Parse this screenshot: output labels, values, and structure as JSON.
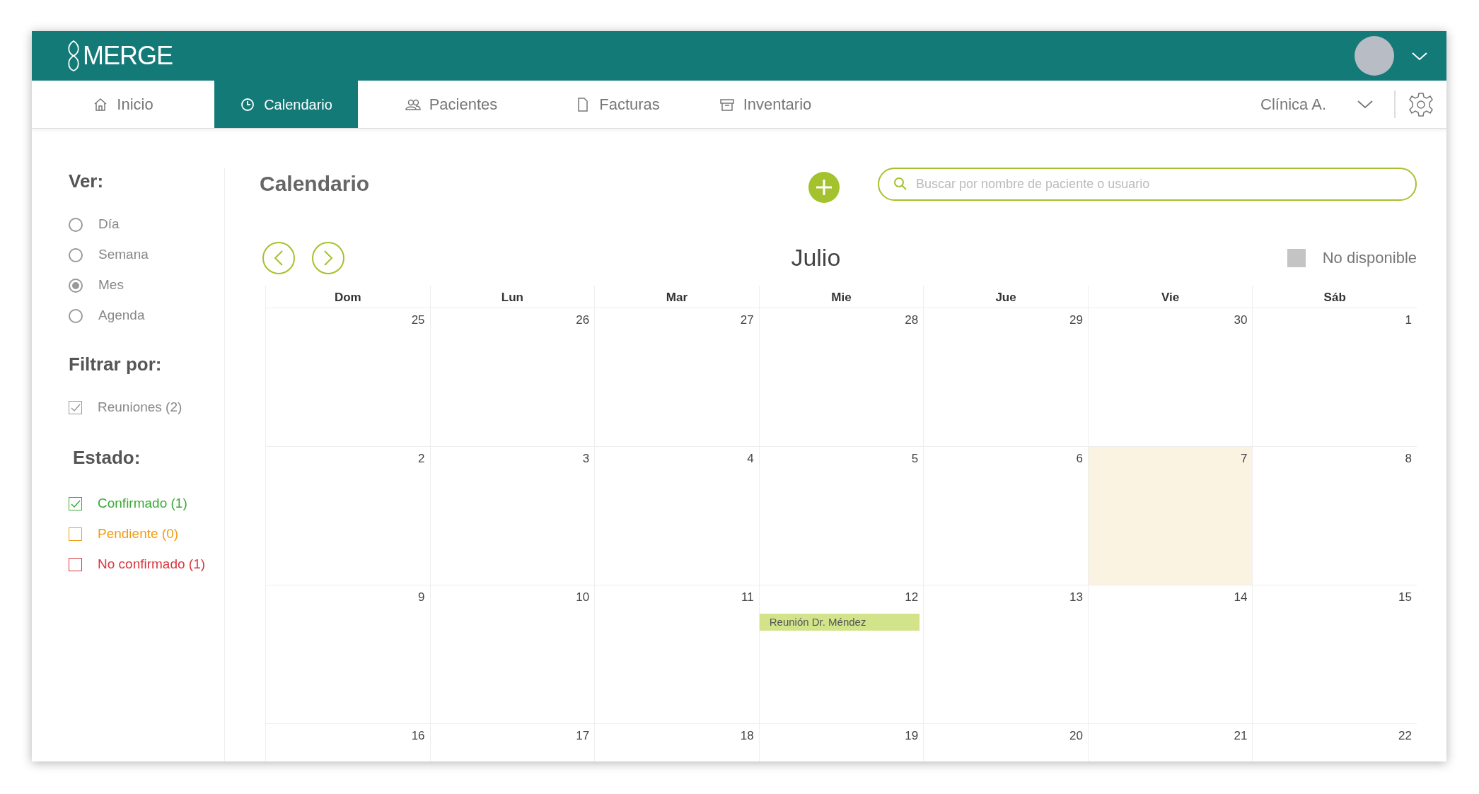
{
  "header": {
    "logo": "MERGE"
  },
  "nav_tabs": [
    {
      "label": "Inicio",
      "kind": "home",
      "selected": false
    },
    {
      "label": "Calendario",
      "kind": "clock",
      "selected": true
    },
    {
      "label": "Pacientes",
      "kind": "people",
      "selected": false
    },
    {
      "label": "Facturas",
      "kind": "file",
      "selected": false
    },
    {
      "label": "Inventario",
      "kind": "archive",
      "selected": false
    }
  ],
  "clinic_selector": {
    "label": "Clínica A."
  },
  "sidebar": {
    "view_title": "Ver:",
    "view_options": [
      {
        "label": "Día",
        "selected": false
      },
      {
        "label": "Semana",
        "selected": false
      },
      {
        "label": "Mes",
        "selected": true
      },
      {
        "label": "Agenda",
        "selected": false
      }
    ],
    "filter_title": "Filtrar por:",
    "filters": [
      {
        "label": "Reuniones (2)",
        "checked": true
      }
    ],
    "status_title": "Estado:",
    "statuses": [
      {
        "label": "Confirmado (1)",
        "checked": true,
        "color": "#3aa935"
      },
      {
        "label": "Pendiente (0)",
        "checked": false,
        "color": "#f39c12"
      },
      {
        "label": "No confirmado (1)",
        "checked": false,
        "color": "#d9363e"
      }
    ]
  },
  "main": {
    "title": "Calendario",
    "search": {
      "placeholder": "Buscar por nombre de paciente o usuario"
    },
    "month": "Julio",
    "legend": {
      "label": "No disponible"
    },
    "weekdays": [
      "Dom",
      "Lun",
      "Mar",
      "Mie",
      "Jue",
      "Vie",
      "Sáb"
    ],
    "weeks": [
      [
        {
          "day": "25",
          "highlighted": false
        },
        {
          "day": "26",
          "highlighted": false
        },
        {
          "day": "27",
          "highlighted": false
        },
        {
          "day": "28",
          "highlighted": false
        },
        {
          "day": "29",
          "highlighted": false
        },
        {
          "day": "30",
          "highlighted": false
        },
        {
          "day": "1",
          "highlighted": false
        }
      ],
      [
        {
          "day": "2",
          "highlighted": false
        },
        {
          "day": "3",
          "highlighted": false
        },
        {
          "day": "4",
          "highlighted": false
        },
        {
          "day": "5",
          "highlighted": false
        },
        {
          "day": "6",
          "highlighted": false
        },
        {
          "day": "7",
          "highlighted": true
        },
        {
          "day": "8",
          "highlighted": false
        }
      ],
      [
        {
          "day": "9",
          "highlighted": false
        },
        {
          "day": "10",
          "highlighted": false
        },
        {
          "day": "11",
          "highlighted": false
        },
        {
          "day": "12",
          "highlighted": false,
          "events": [
            "Reunión Dr. Méndez"
          ]
        },
        {
          "day": "13",
          "highlighted": false
        },
        {
          "day": "14",
          "highlighted": false
        },
        {
          "day": "15",
          "highlighted": false
        }
      ],
      [
        {
          "day": "16",
          "highlighted": false
        },
        {
          "day": "17",
          "highlighted": false
        },
        {
          "day": "18",
          "highlighted": false
        },
        {
          "day": "19",
          "highlighted": false
        },
        {
          "day": "20",
          "highlighted": false
        },
        {
          "day": "21",
          "highlighted": false
        },
        {
          "day": "22",
          "highlighted": false
        }
      ]
    ]
  }
}
